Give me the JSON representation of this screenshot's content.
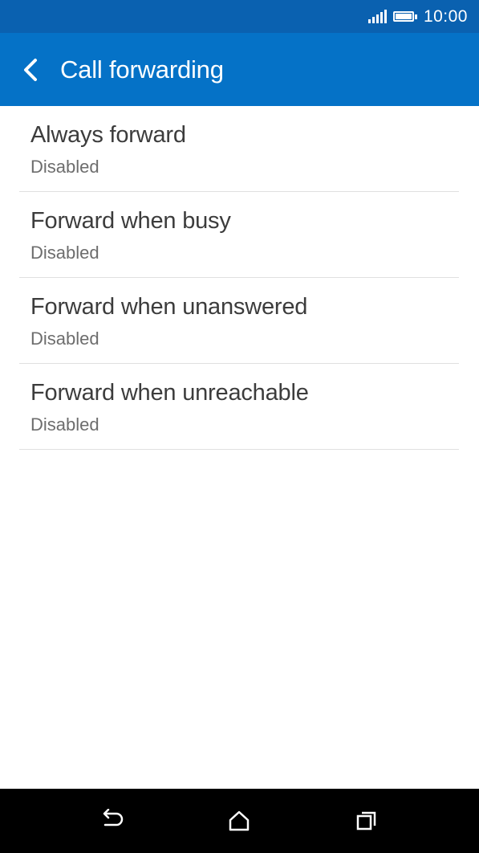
{
  "status_bar": {
    "time": "10:00",
    "signal_icon": "signal-bars-icon",
    "battery_icon": "battery-full-icon"
  },
  "app_bar": {
    "title": "Call forwarding",
    "back_icon": "chevron-left-icon",
    "color": "#0572c7",
    "status_color": "#0a61b0"
  },
  "items": [
    {
      "title": "Always forward",
      "subtitle": "Disabled"
    },
    {
      "title": "Forward when busy",
      "subtitle": "Disabled"
    },
    {
      "title": "Forward when unanswered",
      "subtitle": "Disabled"
    },
    {
      "title": "Forward when unreachable",
      "subtitle": "Disabled"
    }
  ],
  "nav_bar": {
    "back_icon": "back-arrow-icon",
    "home_icon": "home-icon",
    "recents_icon": "recents-icon"
  }
}
